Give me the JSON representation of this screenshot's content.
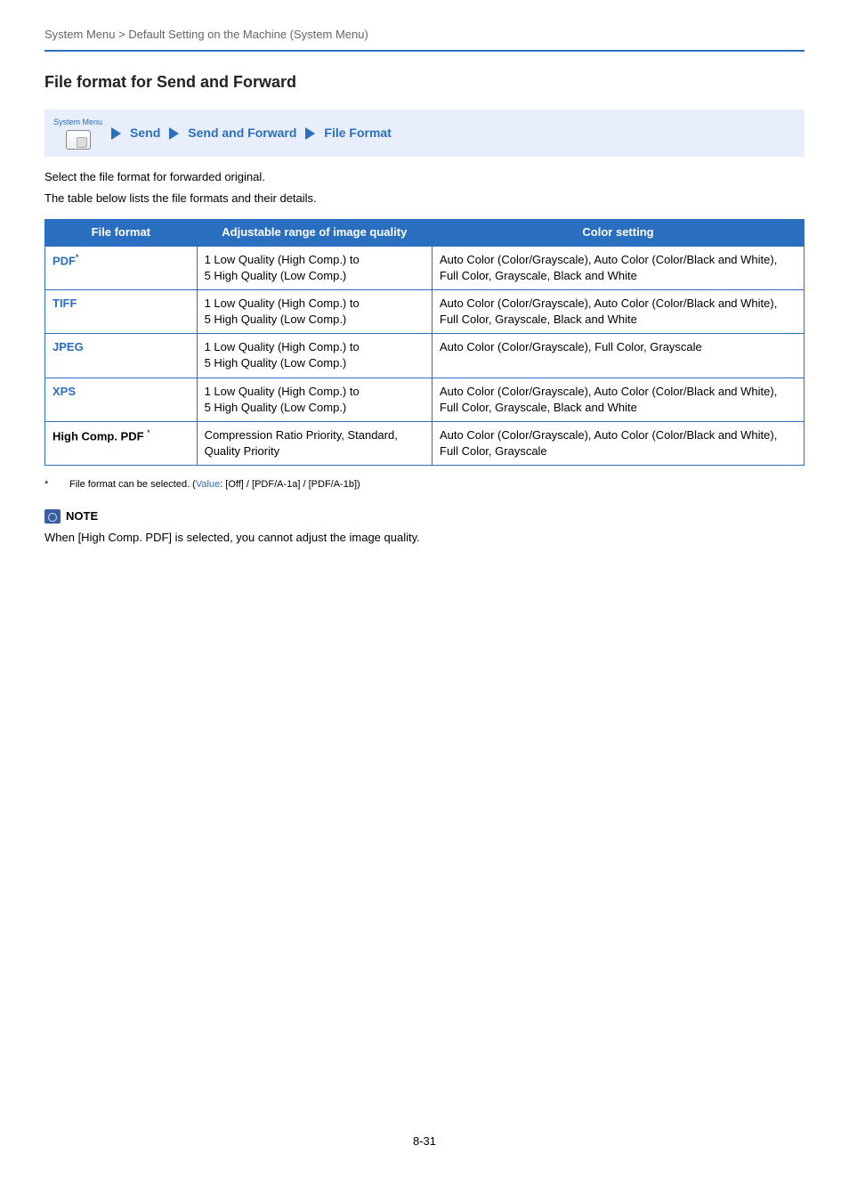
{
  "header": {
    "breadcrumb": "System Menu > Default Setting on the Machine (System Menu)"
  },
  "section": {
    "title": "File format for Send and Forward"
  },
  "nav": {
    "sys_label": "System Menu",
    "step1": "Send",
    "step2": "Send and Forward",
    "step3": "File Format"
  },
  "intro": {
    "p1": "Select the file format for forwarded original.",
    "p2": "The table below lists the file formats and their details."
  },
  "table": {
    "headers": {
      "col1": "File format",
      "col2": "Adjustable range of image quality",
      "col3": "Color setting"
    },
    "rows": [
      {
        "name": "PDF",
        "asterisk": "*",
        "blue_name": true,
        "range": "1 Low Quality (High Comp.) to\n5 High Quality (Low Comp.)",
        "color": "Auto Color (Color/Grayscale), Auto Color (Color/Black and White), Full Color, Grayscale, Black and White"
      },
      {
        "name": "TIFF",
        "asterisk": "",
        "blue_name": true,
        "range": "1 Low Quality (High Comp.) to\n5 High Quality (Low Comp.)",
        "color": "Auto Color (Color/Grayscale), Auto Color (Color/Black and White), Full Color, Grayscale, Black and White"
      },
      {
        "name": "JPEG",
        "asterisk": "",
        "blue_name": true,
        "range": "1 Low Quality (High Comp.) to\n5 High Quality (Low Comp.)",
        "color": "Auto Color (Color/Grayscale), Full Color, Grayscale"
      },
      {
        "name": "XPS",
        "asterisk": "",
        "blue_name": true,
        "range": "1 Low Quality (High Comp.) to\n5 High Quality (Low Comp.)",
        "color": "Auto Color (Color/Grayscale), Auto Color (Color/Black and White), Full Color, Grayscale, Black and White"
      },
      {
        "name": "High Comp. PDF ",
        "asterisk": "*",
        "blue_name": false,
        "range": "Compression Ratio Priority, Standard, Quality Priority",
        "color": "Auto Color (Color/Grayscale), Auto Color (Color/Black and White), Full Color, Grayscale"
      }
    ]
  },
  "footnote": {
    "star": "*",
    "pre": "File format can be selected. (",
    "value_label": "Value",
    "post": ": [Off] / [PDF/A-1a] / [PDF/A-1b])"
  },
  "note": {
    "label": "NOTE",
    "body": "When [High Comp. PDF] is selected, you cannot adjust the image quality."
  },
  "page_number": "8-31"
}
